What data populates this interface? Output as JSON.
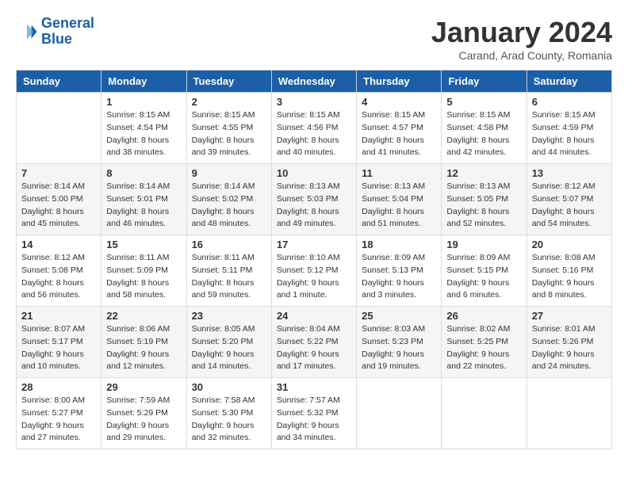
{
  "header": {
    "logo_general": "General",
    "logo_blue": "Blue",
    "title": "January 2024",
    "subtitle": "Carand, Arad County, Romania"
  },
  "days_of_week": [
    "Sunday",
    "Monday",
    "Tuesday",
    "Wednesday",
    "Thursday",
    "Friday",
    "Saturday"
  ],
  "weeks": [
    [
      {
        "day": "",
        "info": ""
      },
      {
        "day": "1",
        "info": "Sunrise: 8:15 AM\nSunset: 4:54 PM\nDaylight: 8 hours\nand 38 minutes."
      },
      {
        "day": "2",
        "info": "Sunrise: 8:15 AM\nSunset: 4:55 PM\nDaylight: 8 hours\nand 39 minutes."
      },
      {
        "day": "3",
        "info": "Sunrise: 8:15 AM\nSunset: 4:56 PM\nDaylight: 8 hours\nand 40 minutes."
      },
      {
        "day": "4",
        "info": "Sunrise: 8:15 AM\nSunset: 4:57 PM\nDaylight: 8 hours\nand 41 minutes."
      },
      {
        "day": "5",
        "info": "Sunrise: 8:15 AM\nSunset: 4:58 PM\nDaylight: 8 hours\nand 42 minutes."
      },
      {
        "day": "6",
        "info": "Sunrise: 8:15 AM\nSunset: 4:59 PM\nDaylight: 8 hours\nand 44 minutes."
      }
    ],
    [
      {
        "day": "7",
        "info": "Sunrise: 8:14 AM\nSunset: 5:00 PM\nDaylight: 8 hours\nand 45 minutes."
      },
      {
        "day": "8",
        "info": "Sunrise: 8:14 AM\nSunset: 5:01 PM\nDaylight: 8 hours\nand 46 minutes."
      },
      {
        "day": "9",
        "info": "Sunrise: 8:14 AM\nSunset: 5:02 PM\nDaylight: 8 hours\nand 48 minutes."
      },
      {
        "day": "10",
        "info": "Sunrise: 8:13 AM\nSunset: 5:03 PM\nDaylight: 8 hours\nand 49 minutes."
      },
      {
        "day": "11",
        "info": "Sunrise: 8:13 AM\nSunset: 5:04 PM\nDaylight: 8 hours\nand 51 minutes."
      },
      {
        "day": "12",
        "info": "Sunrise: 8:13 AM\nSunset: 5:05 PM\nDaylight: 8 hours\nand 52 minutes."
      },
      {
        "day": "13",
        "info": "Sunrise: 8:12 AM\nSunset: 5:07 PM\nDaylight: 8 hours\nand 54 minutes."
      }
    ],
    [
      {
        "day": "14",
        "info": "Sunrise: 8:12 AM\nSunset: 5:08 PM\nDaylight: 8 hours\nand 56 minutes."
      },
      {
        "day": "15",
        "info": "Sunrise: 8:11 AM\nSunset: 5:09 PM\nDaylight: 8 hours\nand 58 minutes."
      },
      {
        "day": "16",
        "info": "Sunrise: 8:11 AM\nSunset: 5:11 PM\nDaylight: 8 hours\nand 59 minutes."
      },
      {
        "day": "17",
        "info": "Sunrise: 8:10 AM\nSunset: 5:12 PM\nDaylight: 9 hours\nand 1 minute."
      },
      {
        "day": "18",
        "info": "Sunrise: 8:09 AM\nSunset: 5:13 PM\nDaylight: 9 hours\nand 3 minutes."
      },
      {
        "day": "19",
        "info": "Sunrise: 8:09 AM\nSunset: 5:15 PM\nDaylight: 9 hours\nand 6 minutes."
      },
      {
        "day": "20",
        "info": "Sunrise: 8:08 AM\nSunset: 5:16 PM\nDaylight: 9 hours\nand 8 minutes."
      }
    ],
    [
      {
        "day": "21",
        "info": "Sunrise: 8:07 AM\nSunset: 5:17 PM\nDaylight: 9 hours\nand 10 minutes."
      },
      {
        "day": "22",
        "info": "Sunrise: 8:06 AM\nSunset: 5:19 PM\nDaylight: 9 hours\nand 12 minutes."
      },
      {
        "day": "23",
        "info": "Sunrise: 8:05 AM\nSunset: 5:20 PM\nDaylight: 9 hours\nand 14 minutes."
      },
      {
        "day": "24",
        "info": "Sunrise: 8:04 AM\nSunset: 5:22 PM\nDaylight: 9 hours\nand 17 minutes."
      },
      {
        "day": "25",
        "info": "Sunrise: 8:03 AM\nSunset: 5:23 PM\nDaylight: 9 hours\nand 19 minutes."
      },
      {
        "day": "26",
        "info": "Sunrise: 8:02 AM\nSunset: 5:25 PM\nDaylight: 9 hours\nand 22 minutes."
      },
      {
        "day": "27",
        "info": "Sunrise: 8:01 AM\nSunset: 5:26 PM\nDaylight: 9 hours\nand 24 minutes."
      }
    ],
    [
      {
        "day": "28",
        "info": "Sunrise: 8:00 AM\nSunset: 5:27 PM\nDaylight: 9 hours\nand 27 minutes."
      },
      {
        "day": "29",
        "info": "Sunrise: 7:59 AM\nSunset: 5:29 PM\nDaylight: 9 hours\nand 29 minutes."
      },
      {
        "day": "30",
        "info": "Sunrise: 7:58 AM\nSunset: 5:30 PM\nDaylight: 9 hours\nand 32 minutes."
      },
      {
        "day": "31",
        "info": "Sunrise: 7:57 AM\nSunset: 5:32 PM\nDaylight: 9 hours\nand 34 minutes."
      },
      {
        "day": "",
        "info": ""
      },
      {
        "day": "",
        "info": ""
      },
      {
        "day": "",
        "info": ""
      }
    ]
  ]
}
